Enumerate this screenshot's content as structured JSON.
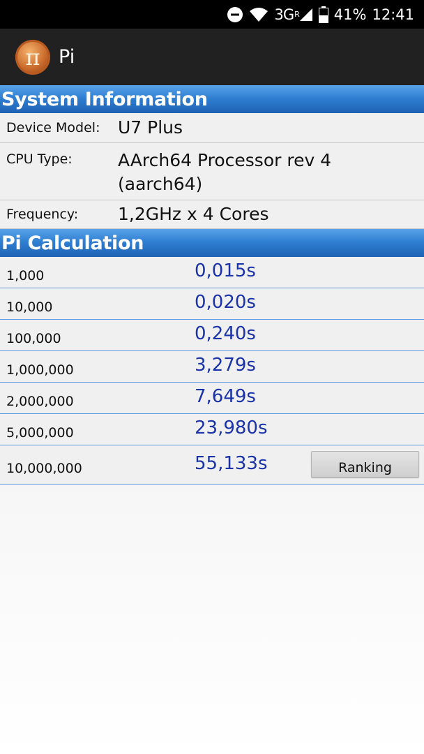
{
  "status_bar": {
    "network": "3G",
    "network_sup": "R",
    "battery": "41%",
    "time": "12:41"
  },
  "app_bar": {
    "title": "Pi",
    "icon_glyph": "π"
  },
  "system_info": {
    "header": "System Information",
    "rows": [
      {
        "label": "Device Model:",
        "value": "U7 Plus"
      },
      {
        "label": "CPU Type:",
        "value": "AArch64 Processor rev 4 (aarch64)"
      },
      {
        "label": "Frequency:",
        "value": "1,2GHz x 4 Cores"
      }
    ]
  },
  "pi_calculation": {
    "header": "Pi Calculation",
    "rows": [
      {
        "digits": "1,000",
        "time": "0,015s"
      },
      {
        "digits": "10,000",
        "time": "0,020s"
      },
      {
        "digits": "100,000",
        "time": "0,240s"
      },
      {
        "digits": "1,000,000",
        "time": "3,279s"
      },
      {
        "digits": "2,000,000",
        "time": "7,649s"
      },
      {
        "digits": "5,000,000",
        "time": "23,980s"
      },
      {
        "digits": "10,000,000",
        "time": "55,133s"
      }
    ],
    "ranking_label": "Ranking"
  },
  "colors": {
    "section_header": "#2f7fd2",
    "time_text": "#1a33a8",
    "app_bar": "#212121"
  }
}
